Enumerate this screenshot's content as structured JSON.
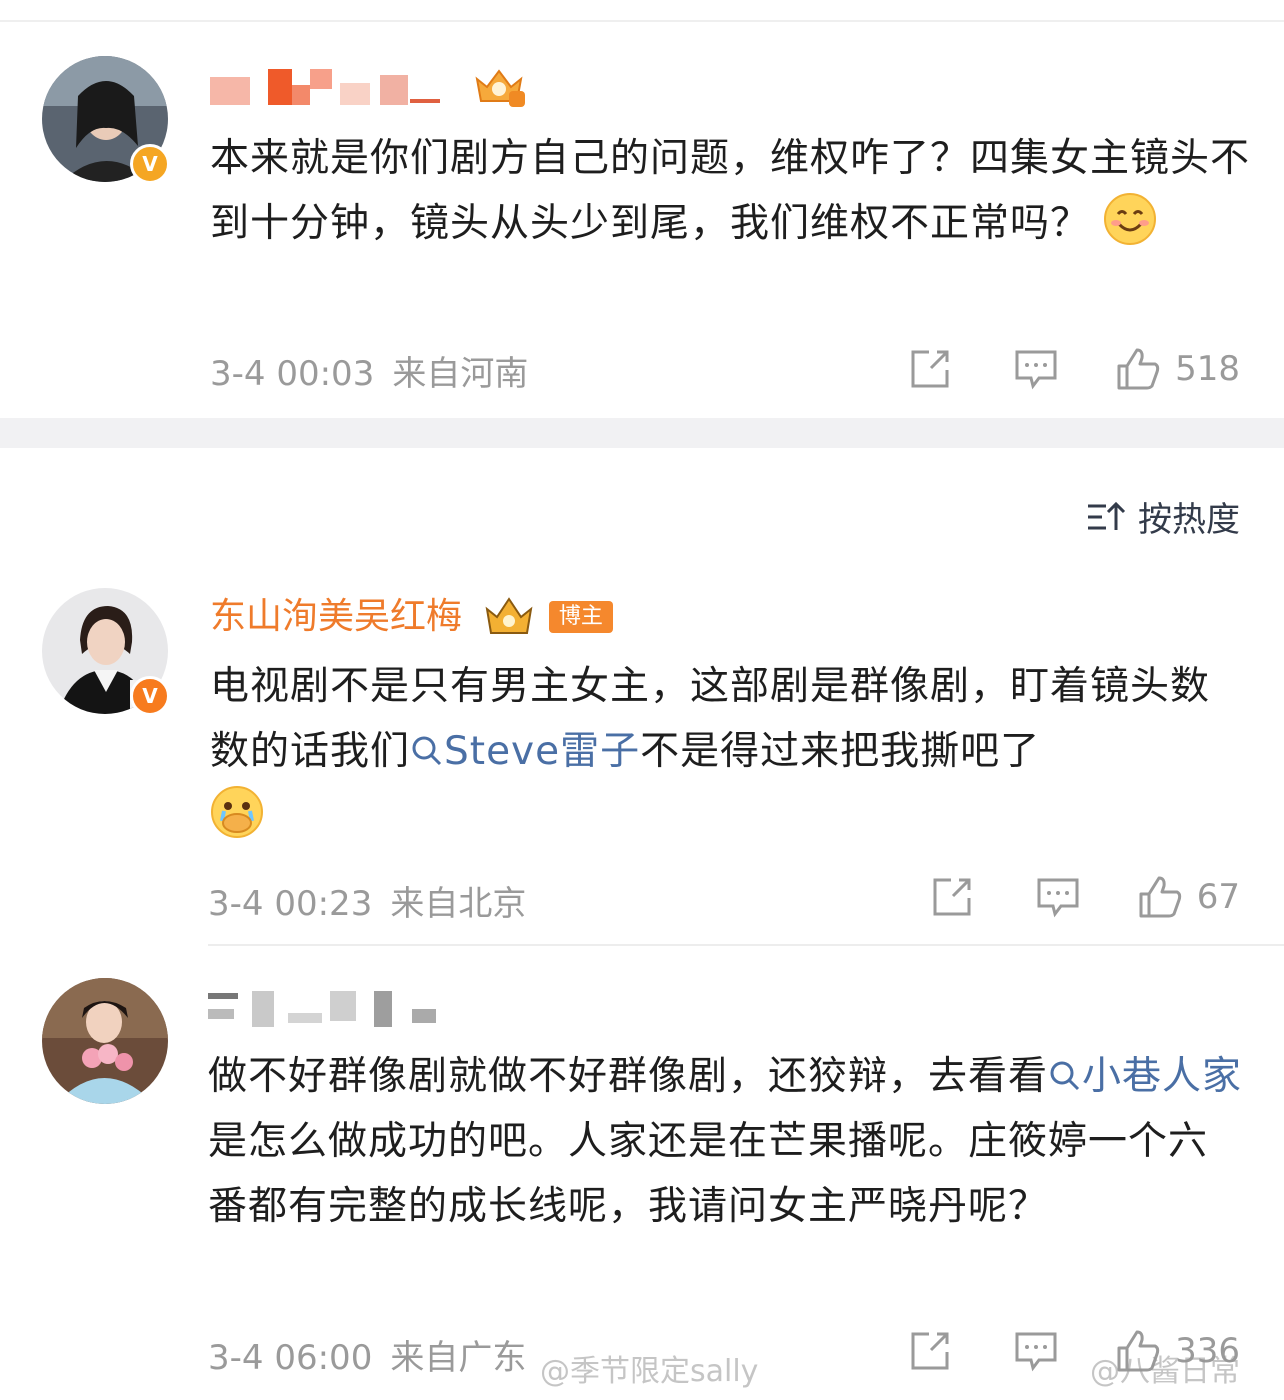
{
  "comments": [
    {
      "username": "",
      "avatar_badge": "V",
      "text": "本来就是你们剧方自己的问题，维权咋了？四集女主镜头不到十分钟，镜头从头少到尾，我们维权不正常吗？",
      "emoji": "smile-emoji",
      "time": "3-4 00:03",
      "location": "来自河南",
      "likes": "518"
    },
    {
      "username": "东山洵美吴红梅",
      "avatar_badge": "V",
      "tag": "博主",
      "text_before": "电视剧不是只有男主女主，这部剧是群像剧，盯着镜头数数的话我们",
      "mention": "Steve雷子",
      "text_after": "不是得过来把我撕吧了",
      "emoji": "crying-covering-mouth-emoji",
      "time": "3-4 00:23",
      "location": "来自北京",
      "likes": "67"
    },
    {
      "username": "",
      "text_before": "做不好群像剧就做不好群像剧，还狡辩，去看看",
      "mention": "小巷人家",
      "text_after": "是怎么做成功的吧。人家还是在芒果播呢。庄筱婷一个六番都有完整的成长线呢，我请问女主严晓丹呢？",
      "time": "3-4 06:00",
      "location": "来自广东",
      "likes": "336"
    }
  ],
  "sort_label": "按热度",
  "watermarks": [
    "@季节限定sally",
    "@八酱日常"
  ],
  "colors": {
    "username_orange": "#ef7b2b",
    "link": "#4a6fa5",
    "meta": "#9a9a9a"
  }
}
